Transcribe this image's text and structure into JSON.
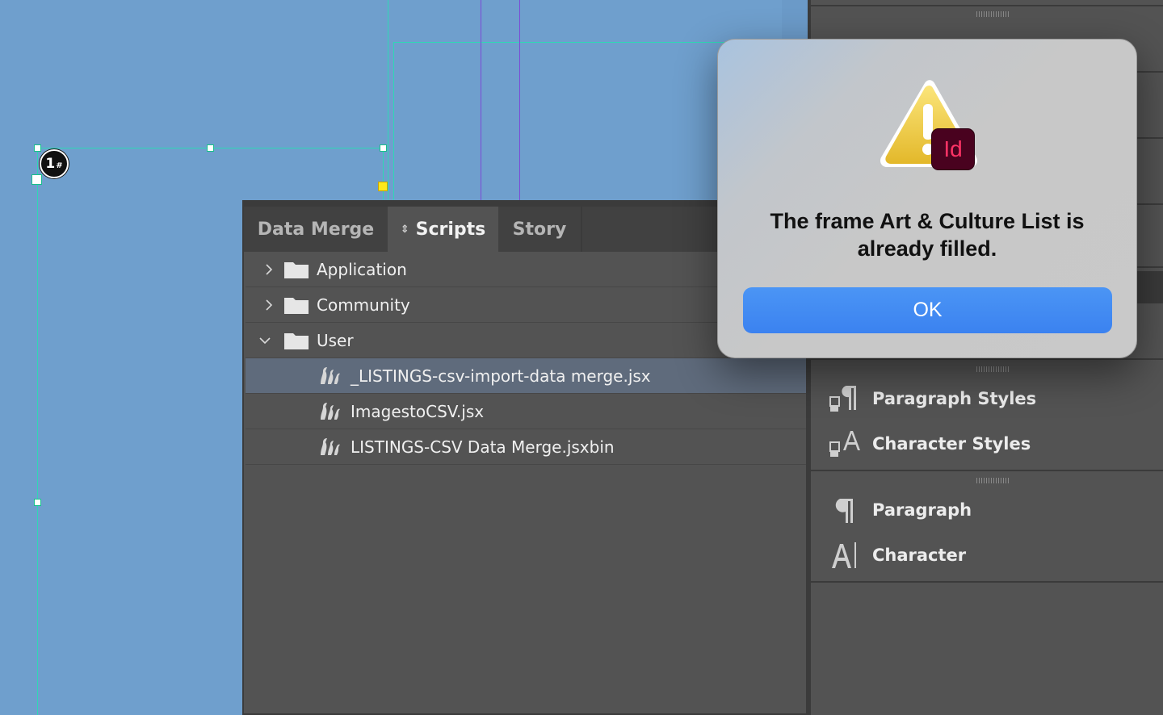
{
  "canvas": {
    "frame_number_label": "1",
    "frame_number_suffix": "#"
  },
  "scripts_panel": {
    "tabs": [
      {
        "label": "Data Merge",
        "active": false
      },
      {
        "label": "Scripts",
        "active": true
      },
      {
        "label": "Story",
        "active": false
      }
    ],
    "tree": [
      {
        "label": "Application",
        "type": "folder",
        "expanded": false
      },
      {
        "label": "Community",
        "type": "folder",
        "expanded": false
      },
      {
        "label": "User",
        "type": "folder",
        "expanded": true
      },
      {
        "label": "_LISTINGS-csv-import-data merge.jsx",
        "type": "script",
        "selected": true
      },
      {
        "label": "ImagestoCSV.jsx",
        "type": "script",
        "selected": false
      },
      {
        "label": "LISTINGS-CSV Data Merge.jsxbin",
        "type": "script",
        "selected": false
      }
    ]
  },
  "dock": {
    "items": [
      {
        "label": "Paragraph Styles",
        "icon": "paragraph-styles-icon"
      },
      {
        "label": "Character Styles",
        "icon": "character-styles-icon"
      },
      {
        "label": "Paragraph",
        "icon": "paragraph-icon"
      },
      {
        "label": "Character",
        "icon": "character-icon"
      }
    ]
  },
  "dialog": {
    "icon": "warning-icon",
    "badge_text": "Id",
    "message": "The frame Art & Culture List is already filled.",
    "ok_label": "OK",
    "colors": {
      "ok_button": "#3b82f0",
      "badge_bg": "#49021f",
      "badge_text": "#ff3366"
    }
  }
}
